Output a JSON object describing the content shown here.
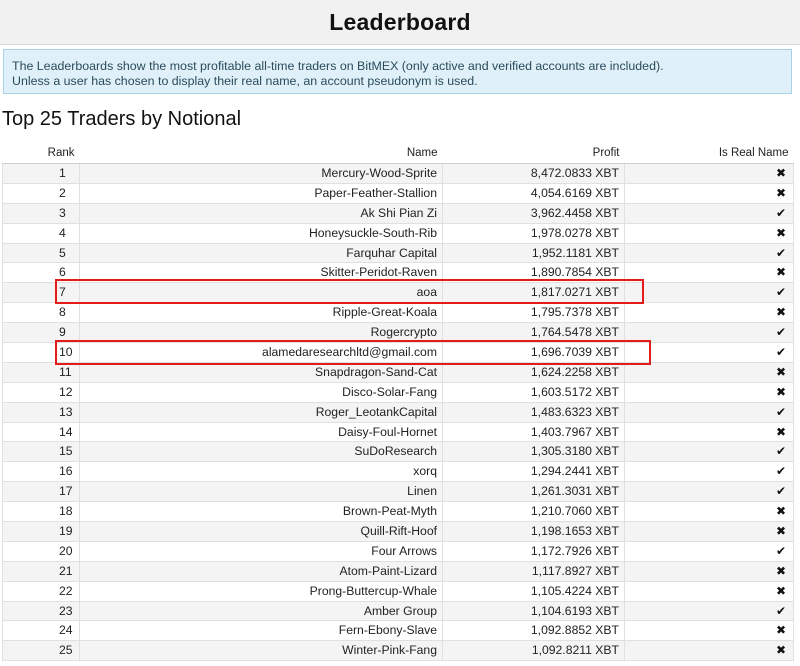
{
  "header": {
    "title": "Leaderboard"
  },
  "info": {
    "line1": "The Leaderboards show the most profitable all-time traders on BitMEX (only active and verified accounts are included).",
    "line2": "Unless a user has chosen to display their real name, an account pseudonym is used."
  },
  "section_title": "Top 25 Traders by Notional",
  "table": {
    "headers": {
      "rank": "Rank",
      "name": "Name",
      "profit": "Profit",
      "is_real_name": "Is Real Name"
    },
    "rows": [
      {
        "rank": "1",
        "name": "Mercury-Wood-Sprite",
        "profit": "8,472.0833 XBT",
        "real": false
      },
      {
        "rank": "2",
        "name": "Paper-Feather-Stallion",
        "profit": "4,054.6169 XBT",
        "real": false
      },
      {
        "rank": "3",
        "name": "Ak Shi Pian Zi",
        "profit": "3,962.4458 XBT",
        "real": true
      },
      {
        "rank": "4",
        "name": "Honeysuckle-South-Rib",
        "profit": "1,978.0278 XBT",
        "real": false
      },
      {
        "rank": "5",
        "name": "Farquhar Capital",
        "profit": "1,952.1181 XBT",
        "real": true
      },
      {
        "rank": "6",
        "name": "Skitter-Peridot-Raven",
        "profit": "1,890.7854 XBT",
        "real": false
      },
      {
        "rank": "7",
        "name": "aoa",
        "profit": "1,817.0271 XBT",
        "real": true
      },
      {
        "rank": "8",
        "name": "Ripple-Great-Koala",
        "profit": "1,795.7378 XBT",
        "real": false
      },
      {
        "rank": "9",
        "name": "Rogercrypto",
        "profit": "1,764.5478 XBT",
        "real": true
      },
      {
        "rank": "10",
        "name": "alamedaresearchltd@gmail.com",
        "profit": "1,696.7039 XBT",
        "real": true
      },
      {
        "rank": "11",
        "name": "Snapdragon-Sand-Cat",
        "profit": "1,624.2258 XBT",
        "real": false
      },
      {
        "rank": "12",
        "name": "Disco-Solar-Fang",
        "profit": "1,603.5172 XBT",
        "real": false
      },
      {
        "rank": "13",
        "name": "Roger_LeotankCapital",
        "profit": "1,483.6323 XBT",
        "real": true
      },
      {
        "rank": "14",
        "name": "Daisy-Foul-Hornet",
        "profit": "1,403.7967 XBT",
        "real": false
      },
      {
        "rank": "15",
        "name": "SuDoResearch",
        "profit": "1,305.3180 XBT",
        "real": true
      },
      {
        "rank": "16",
        "name": "xorq",
        "profit": "1,294.2441 XBT",
        "real": true
      },
      {
        "rank": "17",
        "name": "Linen",
        "profit": "1,261.3031 XBT",
        "real": true
      },
      {
        "rank": "18",
        "name": "Brown-Peat-Myth",
        "profit": "1,210.7060 XBT",
        "real": false
      },
      {
        "rank": "19",
        "name": "Quill-Rift-Hoof",
        "profit": "1,198.1653 XBT",
        "real": false
      },
      {
        "rank": "20",
        "name": "Four Arrows",
        "profit": "1,172.7926 XBT",
        "real": true
      },
      {
        "rank": "21",
        "name": "Atom-Paint-Lizard",
        "profit": "1,117.8927 XBT",
        "real": false
      },
      {
        "rank": "22",
        "name": "Prong-Buttercup-Whale",
        "profit": "1,105.4224 XBT",
        "real": false
      },
      {
        "rank": "23",
        "name": "Amber Group",
        "profit": "1,104.6193 XBT",
        "real": true
      },
      {
        "rank": "24",
        "name": "Fern-Ebony-Slave",
        "profit": "1,092.8852 XBT",
        "real": false
      },
      {
        "rank": "25",
        "name": "Winter-Pink-Fang",
        "profit": "1,092.8211 XBT",
        "real": false
      }
    ]
  },
  "icons": {
    "true": "checkmark-icon",
    "false": "cross-icon"
  },
  "colors": {
    "highlight": "#e31b1b",
    "info_bg": "#dff0f8",
    "info_border": "#a9d2e6"
  }
}
